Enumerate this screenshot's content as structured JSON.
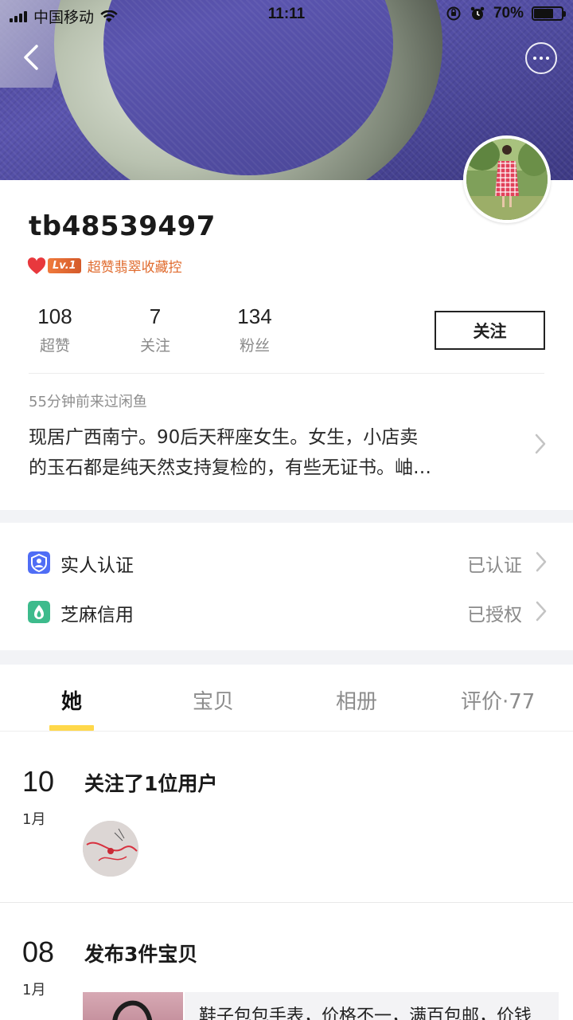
{
  "status_bar": {
    "carrier": "中国移动",
    "time": "11:11",
    "battery": "70%",
    "battery_level": 0.7
  },
  "profile": {
    "username": "tb48539497",
    "level_badge": "Lv.1",
    "level_title": "超赞翡翠收藏控",
    "stats": [
      {
        "value": "108",
        "label": "超赞"
      },
      {
        "value": "7",
        "label": "关注"
      },
      {
        "value": "134",
        "label": "粉丝"
      }
    ],
    "follow_button": "关注",
    "last_visit": "55分钟前来过闲鱼",
    "bio_line1": "现居广西南宁。90后天秤座女生。女生，小店卖",
    "bio_line2": "的玉石都是纯天然支持复检的，有些无证书。岫…"
  },
  "auth": [
    {
      "label": "实人认证",
      "value": "已认证",
      "icon": "person-verify-icon",
      "color": "#4f6df5"
    },
    {
      "label": "芝麻信用",
      "value": "已授权",
      "icon": "sesame-credit-icon",
      "color": "#3dbb8c"
    }
  ],
  "tabs": [
    {
      "label": "她",
      "active": true
    },
    {
      "label": "宝贝",
      "active": false
    },
    {
      "label": "相册",
      "active": false
    },
    {
      "label": "评价·77",
      "active": false
    }
  ],
  "feed": [
    {
      "day": "10",
      "month": "1月",
      "title": "关注了1位用户"
    },
    {
      "day": "08",
      "month": "1月",
      "title": "发布3件宝贝",
      "item_text": "鞋子包包手表，价格不一，满百包邮，价钱"
    }
  ],
  "colors": {
    "accent_yellow": "#ffd84a",
    "level_orange": "#e06b2e",
    "section_gap": "#f2f3f6"
  }
}
